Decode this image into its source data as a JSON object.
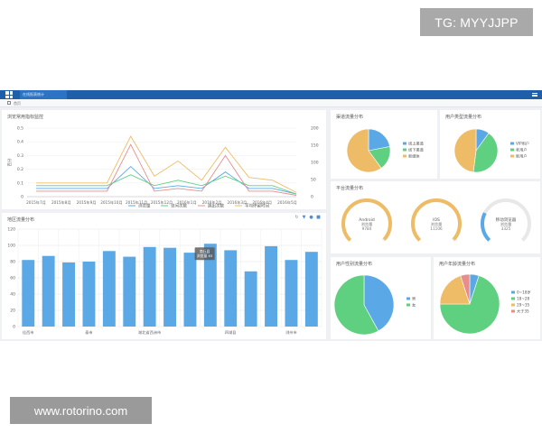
{
  "watermarks": {
    "top": "TG: MYYJJPP",
    "bottom": "www.rotorino.com"
  },
  "header": {
    "tab_label": "在线报表统计",
    "breadcrumb": "首页"
  },
  "colors": {
    "blue": "#5aa9e6",
    "green": "#5fcf80",
    "orange": "#eebc66",
    "red": "#e88c8c",
    "teal": "#5bc8c4",
    "header": "#1f5ea8"
  },
  "panels": {
    "traffic": {
      "title": "浏览常用指标监控"
    },
    "region": {
      "title": "地区流量分布"
    },
    "channel": {
      "title": "渠道流量分布"
    },
    "usertype": {
      "title": "用户类型流量分布"
    },
    "platform": {
      "title": "平台流量分布"
    },
    "gender": {
      "title": "用户性别流量分布"
    },
    "age": {
      "title": "用户年龄流量分布"
    }
  },
  "chart_data": [
    {
      "type": "line",
      "x": [
        "2015年7月",
        "2015年8月",
        "2015年9月",
        "2015年10月",
        "2015年11月",
        "2015年12月",
        "2016年1月",
        "2016年2月",
        "2016年3月",
        "2016年4月",
        "2016年5月"
      ],
      "ylim": [
        0,
        0.5
      ],
      "y_ticks": [
        "0",
        "0.1",
        "0.2",
        "0.3",
        "0.4",
        "0.5"
      ],
      "ylim_right": [
        0,
        200
      ],
      "y_ticks_right": [
        "0",
        "50",
        "100",
        "150",
        "200"
      ],
      "ylabel": "百分",
      "legend_position": "bottom",
      "series": [
        {
          "name": "浏览量",
          "axis": "left",
          "color": "#5aa9e6",
          "values": [
            0.06,
            0.06,
            0.06,
            0.06,
            0.22,
            0.06,
            0.08,
            0.06,
            0.18,
            0.06,
            0.06,
            0.02
          ]
        },
        {
          "name": "访问次数",
          "axis": "left",
          "color": "#5fcf80",
          "values": [
            0.08,
            0.08,
            0.08,
            0.08,
            0.16,
            0.08,
            0.12,
            0.08,
            0.15,
            0.08,
            0.08,
            0.02
          ]
        },
        {
          "name": "跳出次数",
          "axis": "left",
          "color": "#e88c8c",
          "values": [
            0.04,
            0.04,
            0.04,
            0.04,
            0.38,
            0.04,
            0.06,
            0.04,
            0.3,
            0.04,
            0.04,
            0.01
          ]
        },
        {
          "name": "平均停留时间",
          "axis": "left",
          "color": "#eebc66",
          "values": [
            0.1,
            0.1,
            0.1,
            0.1,
            0.44,
            0.15,
            0.26,
            0.12,
            0.36,
            0.14,
            0.12,
            0.03
          ]
        }
      ]
    },
    {
      "type": "bar",
      "categories": [
        "1",
        "2",
        "3",
        "4",
        "5",
        "6",
        "7",
        "8",
        "9",
        "10",
        "11",
        "12",
        "13",
        "14",
        "15"
      ],
      "x_labels": [
        "佳西市",
        "",
        "",
        "泰市",
        "",
        "",
        "湖北省西洲市",
        "",
        "",
        "",
        "四湖县",
        "",
        "",
        "浏州市",
        ""
      ],
      "values": [
        82,
        87,
        79,
        80,
        93,
        86,
        98,
        97,
        91,
        102,
        94,
        68,
        99,
        82,
        92
      ],
      "ylim": [
        0,
        120
      ],
      "y_ticks": [
        "0",
        "20",
        "40",
        "60",
        "80",
        "100",
        "120"
      ],
      "color": "#5aa9e6",
      "tooltip": {
        "index": 9,
        "lines": [
          "商丘县",
          "浏览量 83"
        ]
      },
      "grid": true
    },
    {
      "type": "pie",
      "title": "渠道流量分布",
      "labels": [
        "线上渠道",
        "线下渠道",
        "新媒体"
      ],
      "values": [
        22,
        18,
        60
      ],
      "colors": [
        "#5aa9e6",
        "#5fcf80",
        "#eebc66"
      ],
      "legend_position": "right"
    },
    {
      "type": "pie",
      "title": "用户类型流量分布",
      "labels": [
        "VIP用户",
        "老用户",
        "新用户"
      ],
      "values": [
        10,
        42,
        48
      ],
      "colors": [
        "#5aa9e6",
        "#5fcf80",
        "#eebc66"
      ],
      "legend_position": "right"
    },
    {
      "type": "gauge",
      "title": "平台流量分布",
      "items": [
        {
          "label": "Android",
          "sub": "浏览量",
          "value": "9784",
          "color": "#eebc66"
        },
        {
          "label": "IOS",
          "sub": "浏览量",
          "value": "11106",
          "color": "#eebc66"
        },
        {
          "label": "移动浏览器",
          "sub": "浏览量",
          "value": "3325",
          "color": "#5aa9e6"
        }
      ]
    },
    {
      "type": "pie",
      "title": "用户性别流量分布",
      "labels": [
        "男",
        "女"
      ],
      "values": [
        42,
        58
      ],
      "colors": [
        "#5aa9e6",
        "#5fcf80"
      ],
      "legend_position": "right"
    },
    {
      "type": "pie",
      "title": "用户年龄流量分布",
      "labels": [
        "0~18岁",
        "18~28",
        "29~35",
        "大于35"
      ],
      "values": [
        5,
        70,
        20,
        5
      ],
      "colors": [
        "#5aa9e6",
        "#5fcf80",
        "#eebc66",
        "#e88c8c"
      ],
      "legend_position": "right"
    }
  ]
}
